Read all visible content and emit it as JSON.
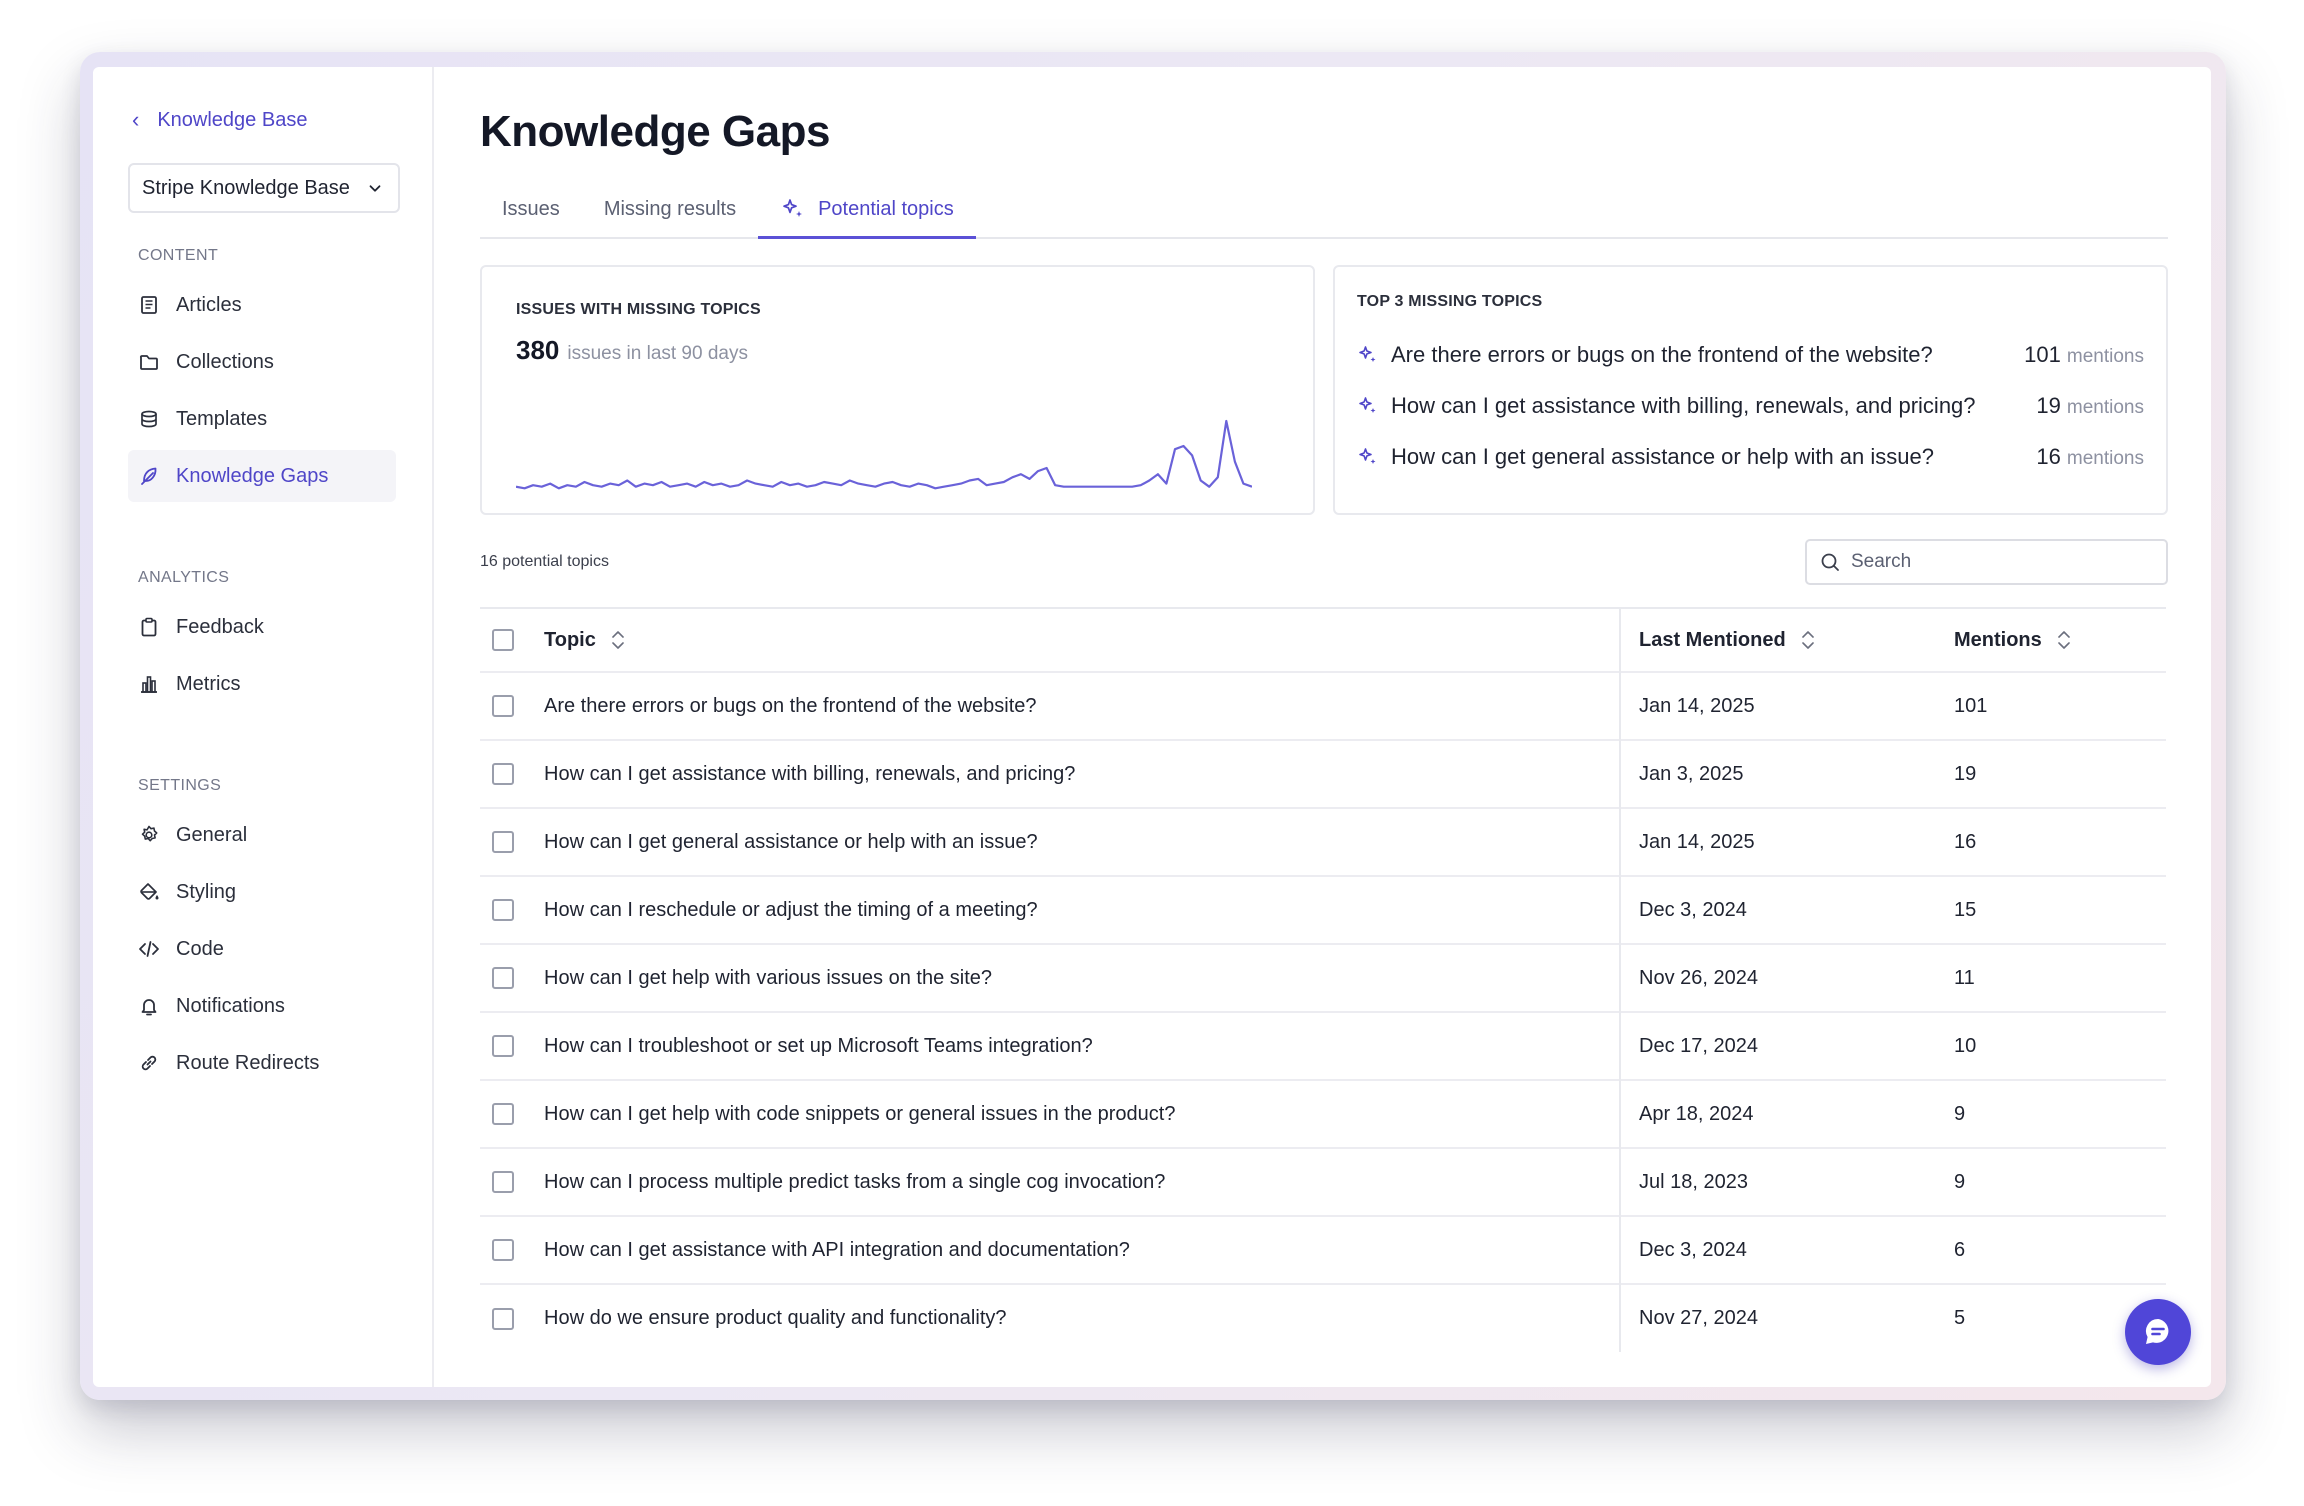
{
  "sidebar": {
    "back_label": "Knowledge Base",
    "kb_select": "Stripe Knowledge Base",
    "content_label": "CONTENT",
    "content_items": [
      "Articles",
      "Collections",
      "Templates",
      "Knowledge Gaps"
    ],
    "analytics_label": "ANALYTICS",
    "analytics_items": [
      "Feedback",
      "Metrics"
    ],
    "settings_label": "SETTINGS",
    "settings_items": [
      "General",
      "Styling",
      "Code",
      "Notifications",
      "Route Redirects"
    ]
  },
  "header": {
    "title": "Knowledge Gaps",
    "tabs": [
      "Issues",
      "Missing results",
      "Potential topics"
    ]
  },
  "issues_card": {
    "label": "ISSUES WITH MISSING TOPICS",
    "count": "380",
    "sub": "issues in last 90 days"
  },
  "top_card": {
    "label": "TOP 3 MISSING TOPICS",
    "mentions_word": "mentions",
    "items": [
      {
        "q": "Are there errors or bugs on the frontend of the website?",
        "n": "101"
      },
      {
        "q": "How can I get assistance with billing, renewals, and pricing?",
        "n": "19"
      },
      {
        "q": "How can I get general assistance or help with an issue?",
        "n": "16"
      }
    ]
  },
  "list": {
    "count_text": "16 potential topics",
    "search_placeholder": "Search",
    "columns": [
      "Topic",
      "Last Mentioned",
      "Mentions"
    ],
    "rows": [
      {
        "topic": "Are there errors or bugs on the frontend of the website?",
        "last": "Jan 14, 2025",
        "mentions": "101"
      },
      {
        "topic": "How can I get assistance with billing, renewals, and pricing?",
        "last": "Jan 3, 2025",
        "mentions": "19"
      },
      {
        "topic": "How can I get general assistance or help with an issue?",
        "last": "Jan 14, 2025",
        "mentions": "16"
      },
      {
        "topic": "How can I reschedule or adjust the timing of a meeting?",
        "last": "Dec 3, 2024",
        "mentions": "15"
      },
      {
        "topic": "How can I get help with various issues on the site?",
        "last": "Nov 26, 2024",
        "mentions": "11"
      },
      {
        "topic": "How can I troubleshoot or set up Microsoft Teams integration?",
        "last": "Dec 17, 2024",
        "mentions": "10"
      },
      {
        "topic": "How can I get help with code snippets or general issues in the product?",
        "last": "Apr 18, 2024",
        "mentions": "9"
      },
      {
        "topic": "How can I process multiple predict tasks from a single cog invocation?",
        "last": "Jul 18, 2023",
        "mentions": "9"
      },
      {
        "topic": "How can I get assistance with API integration and documentation?",
        "last": "Dec 3, 2024",
        "mentions": "6"
      },
      {
        "topic": "How do we ensure product quality and functionality?",
        "last": "Nov 27, 2024",
        "mentions": "5"
      }
    ]
  },
  "sparkline": [
    4,
    3,
    5,
    4,
    6,
    3,
    5,
    4,
    7,
    5,
    4,
    6,
    5,
    8,
    4,
    6,
    5,
    7,
    4,
    5,
    6,
    4,
    7,
    5,
    6,
    4,
    5,
    8,
    6,
    5,
    4,
    7,
    5,
    6,
    4,
    5,
    7,
    6,
    5,
    8,
    6,
    5,
    4,
    6,
    7,
    5,
    4,
    6,
    5,
    3,
    4,
    5,
    6,
    8,
    9,
    5,
    6,
    7,
    10,
    12,
    9,
    14,
    16,
    5,
    4,
    4,
    4,
    4,
    4,
    4,
    4,
    4,
    4,
    5,
    8,
    12,
    6,
    28,
    30,
    24,
    8,
    4,
    10,
    46,
    20,
    6,
    4
  ],
  "colors": {
    "accent": "#4f46c8",
    "fab": "#5046d8"
  }
}
